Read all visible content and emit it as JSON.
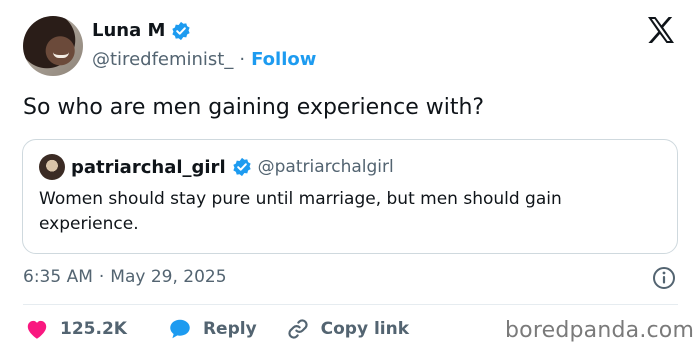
{
  "author": {
    "name": "Luna M",
    "handle": "@tiredfeminist_",
    "separator": "·",
    "follow_label": "Follow"
  },
  "tweet": {
    "text": "So who are men gaining experience with?",
    "time": "6:35 AM",
    "date_separator": "·",
    "date": "May 29, 2025"
  },
  "quoted": {
    "name": "patriarchal_girl",
    "handle": "@patriarchalgirl",
    "text": "Women should stay pure until marriage, but men should gain experience."
  },
  "actions": {
    "likes_count": "125.2K",
    "reply_label": "Reply",
    "copy_link_label": "Copy link"
  },
  "watermark": "boredpanda.com",
  "colors": {
    "accent": "#1d9bf0",
    "like": "#f91880",
    "secondary_text": "#536471",
    "border": "#cfd9de"
  },
  "icons": {
    "verified": "verified-badge-icon",
    "brand": "x-logo-icon",
    "info": "info-icon",
    "like": "heart-icon",
    "reply": "speech-bubble-icon",
    "copy": "link-icon"
  }
}
